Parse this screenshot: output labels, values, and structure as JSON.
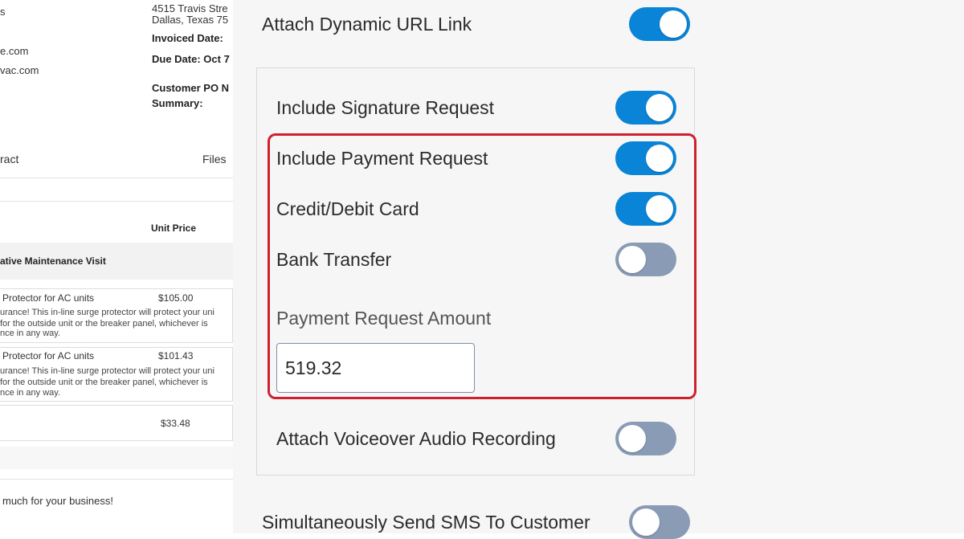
{
  "invoice": {
    "header_fragment": "s",
    "address_line1": "4515 Travis Stre",
    "address_line2": "Dallas, Texas 75",
    "invoiced_date_label": "Invoiced Date:",
    "email_fragment1": "e.com",
    "due_date": "Due Date: Oct 7",
    "email_fragment2": "vac.com",
    "customer_po": "Customer PO N",
    "summary_label": "Summary:",
    "contract_fragment": "ract",
    "files_label": "Files",
    "unit_price_header": "Unit Price",
    "section_title": "ative Maintenance Visit",
    "items": [
      {
        "name": "Protector for AC units",
        "price": "$105.00",
        "desc1": "urance! This in-line surge protector will protect your uni",
        "desc2": "for the outside unit or the breaker panel, whichever is",
        "desc3": "nce in any way."
      },
      {
        "name": "Protector for AC units",
        "price": "$101.43",
        "desc1": "urance! This in-line surge protector will protect your uni",
        "desc2": "for the outside unit or the breaker panel, whichever is",
        "desc3": "nce in any way."
      }
    ],
    "extra_price": "$33.48",
    "thanks": "much for your business!"
  },
  "panel": {
    "attach_dynamic_url": {
      "label": "Attach Dynamic URL Link",
      "on": true
    },
    "signature_request": {
      "label": "Include Signature Request",
      "on": true
    },
    "payment_request": {
      "label": "Include Payment Request",
      "on": true
    },
    "credit_debit": {
      "label": "Credit/Debit Card",
      "on": true
    },
    "bank_transfer": {
      "label": "Bank Transfer",
      "on": false
    },
    "amount": {
      "label": "Payment Request Amount",
      "value": "519.32"
    },
    "voiceover": {
      "label": "Attach Voiceover Audio Recording",
      "on": false
    },
    "sms": {
      "label": "Simultaneously Send SMS To Customer",
      "on": false
    }
  },
  "colors": {
    "toggle_on": "#0a84d6",
    "toggle_off": "#8a9bb5",
    "highlight": "#d0202e"
  }
}
